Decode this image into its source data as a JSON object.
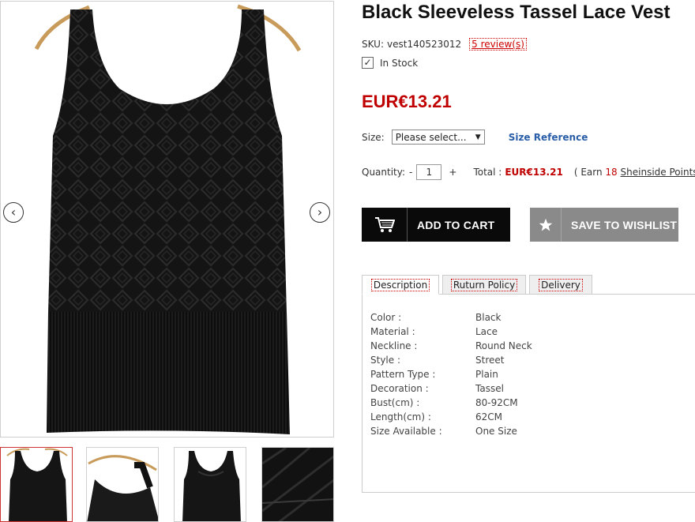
{
  "product": {
    "title": "Black Sleeveless Tassel Lace Vest",
    "sku_label": "SKU:",
    "sku": "vest140523012",
    "reviews": "5 review(s)",
    "stock": "In Stock",
    "price": "EUR€13.21"
  },
  "gallery": {
    "prev_icon": "chevron-left-icon",
    "next_icon": "chevron-right-icon",
    "thumbnail_count": 4
  },
  "size": {
    "label": "Size:",
    "selected": "Please select...",
    "reference_link": "Size Reference"
  },
  "quantity": {
    "label": "Quantity:",
    "minus": "-",
    "value": "1",
    "plus": "+",
    "total_label": "Total :",
    "total_value": "EUR€13.21",
    "earn_prefix": "( Earn",
    "earn_points": "18",
    "earn_link": "Sheinside Points",
    "earn_suffix": ")"
  },
  "buttons": {
    "add_to_cart": "ADD TO CART",
    "save_to_wishlist": "SAVE TO WISHLIST",
    "cart_icon": "cart-icon",
    "wishlist_icon": "star-icon"
  },
  "tabs": [
    {
      "label": "Description"
    },
    {
      "label": "Ruturn Policy"
    },
    {
      "label": "Delivery"
    }
  ],
  "specs": [
    {
      "key": "Color :",
      "value": "Black"
    },
    {
      "key": "Material :",
      "value": "Lace"
    },
    {
      "key": "Neckline :",
      "value": "Round Neck"
    },
    {
      "key": "Style :",
      "value": "Street"
    },
    {
      "key": "Pattern Type :",
      "value": "Plain"
    },
    {
      "key": "Decoration :",
      "value": "Tassel"
    },
    {
      "key": "Bust(cm) :",
      "value": "80-92CM"
    },
    {
      "key": "Length(cm) :",
      "value": "62CM"
    },
    {
      "key": "Size Available :",
      "value": "One Size"
    }
  ],
  "colors": {
    "price": "#c00000",
    "link": "#2a5ea8",
    "cart_button": "#0a0a0a",
    "wishlist_button": "#8a8a8a"
  }
}
